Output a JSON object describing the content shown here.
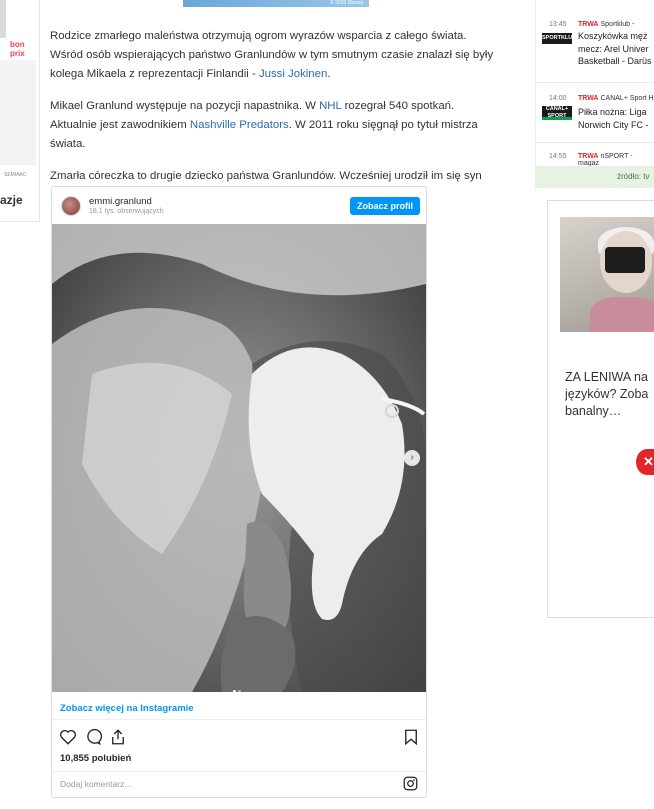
{
  "left_ad": {
    "logo_text": "bon prix",
    "small_text": "SEMIAAC",
    "word": "azje"
  },
  "top_strip": {
    "caption": "© 2020 Disney"
  },
  "article": {
    "p1_text": "Rodzice zmarłego maleństwa otrzymują ogrom wyrazów wsparcia z całego świata. Wśród osób wspierających państwo Granlundów w tym smutnym czasie znalazł się były kolega Mikaela z reprezentacji Finlandii - ",
    "p1_link": "Jussi Jokinen",
    "p1_end": ".",
    "p2_a": "Mikael Granlund występuje na pozycji napastnika. W ",
    "p2_link1": "NHL",
    "p2_b": " rozegrał 540 spotkań. Aktualnie jest zawodnikiem ",
    "p2_link2": "Nashville Predators",
    "p2_c": ". W 2011 roku sięgnął po tytuł mistrza świata.",
    "p3_text": "Zmarła córeczka to drugie dziecko państwa Granlundów. Wcześniej urodził im się syn Mil."
  },
  "instagram": {
    "username": "emmi.granlund",
    "followers": "18,1 tys. obserwujących",
    "profile_button": "Zobacz profil",
    "more_link": "Zobacz więcej na Instagramie",
    "likes": "10,855 polubień",
    "comment_placeholder": "Dodaj komentarz...",
    "photo_icon": "next-arrow-icon",
    "carousel_count": 2,
    "carousel_active": 1
  },
  "tv": {
    "items": [
      {
        "time": "13:45",
        "live": "TRWA",
        "channel": "Sportklub -",
        "logo": "SPORTKLUB",
        "logo_color": "#d9262c",
        "line1": "Koszykówka męż",
        "line2": "mecz: Arel Univer",
        "line3": "Basketball - Darüs"
      },
      {
        "time": "14:00",
        "live": "TRWA",
        "channel": "CANAL+ Sport H",
        "logo": "CANAL+ SPORT",
        "logo_color": "#00a651",
        "line1": "Piłka nożna: Liga",
        "line2": "Norwich City FC -",
        "line3": ""
      },
      {
        "time": "14:55",
        "live": "TRWA",
        "channel": "nSPORT - magaz",
        "logo": "",
        "logo_color": "",
        "line1": "",
        "line2": "",
        "line3": ""
      }
    ],
    "source": "źródło: tv"
  },
  "right_ad": {
    "line1": "ZA LENIWA na",
    "line2": "języków? Zoba",
    "line3": "banalny…",
    "close_icon": "x-close-icon",
    "accent": "#e3262b"
  }
}
